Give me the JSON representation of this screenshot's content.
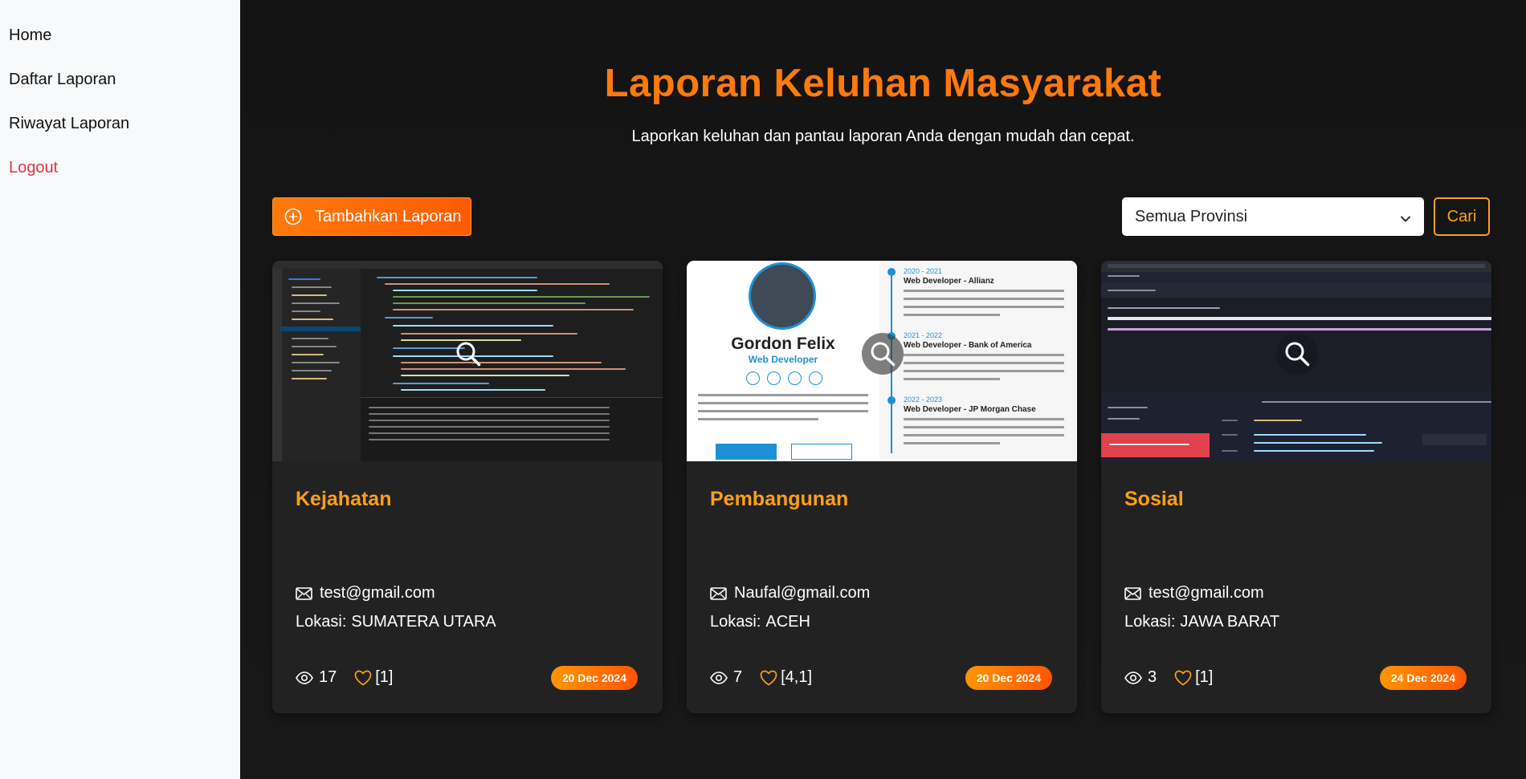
{
  "sidebar": {
    "items": [
      {
        "label": "Home"
      },
      {
        "label": "Daftar Laporan"
      },
      {
        "label": "Riwayat Laporan"
      },
      {
        "label": "Logout"
      }
    ]
  },
  "header": {
    "title": "Laporan Keluhan Masyarakat",
    "subtitle": "Laporkan keluhan dan pantau laporan Anda dengan mudah dan cepat."
  },
  "toolbar": {
    "add_label": "Tambahkan Laporan",
    "province_selected": "Semua Provinsi",
    "search_label": "Cari"
  },
  "colors": {
    "accent": "#ff7a0c",
    "title": "#ff9f1a",
    "logout": "#dc3545"
  },
  "thumbnail_text": {
    "cv_name": "Gordon Felix",
    "cv_role": "Web Developer",
    "cv_jobs": [
      {
        "years": "2020 - 2021",
        "title": "Web Developer - Allianz"
      },
      {
        "years": "2021 - 2022",
        "title": "Web Developer - Bank of America"
      },
      {
        "years": "2022 - 2023",
        "title": "Web Developer - JP Morgan Chase"
      }
    ]
  },
  "reports": [
    {
      "category": "Kejahatan",
      "email": "test@gmail.com",
      "location_label": "Lokasi:",
      "location": "SUMATERA UTARA",
      "views": "17",
      "likes": "[1]",
      "date": "20 Dec 2024",
      "thumbnail": "code-editor-screenshot"
    },
    {
      "category": "Pembangunan",
      "email": "Naufal@gmail.com",
      "location_label": "Lokasi:",
      "location": "ACEH",
      "views": "7",
      "likes": "[4,1]",
      "date": "20 Dec 2024",
      "thumbnail": "cv-screenshot"
    },
    {
      "category": "Sosial",
      "email": "test@gmail.com",
      "location_label": "Lokasi:",
      "location": "JAWA BARAT",
      "views": "3",
      "likes": "[1]",
      "date": "24 Dec 2024",
      "thumbnail": "error-page-screenshot"
    }
  ]
}
